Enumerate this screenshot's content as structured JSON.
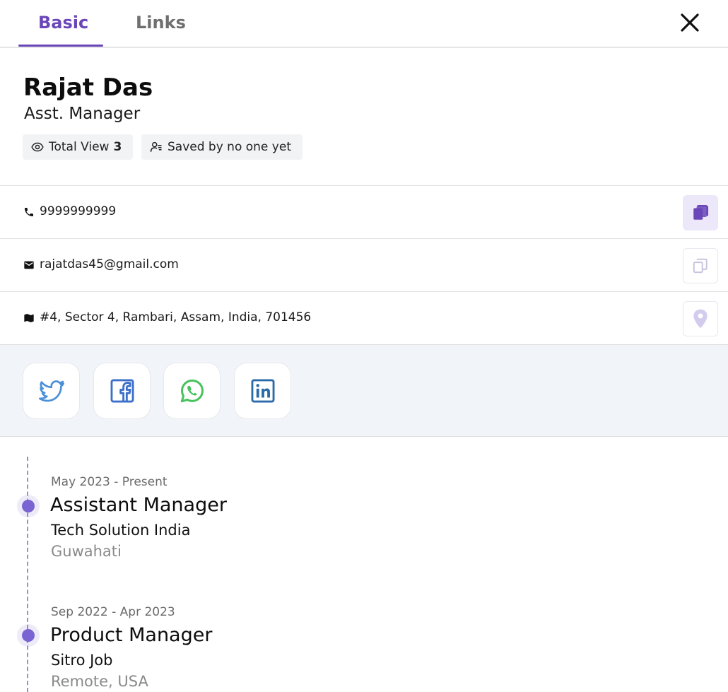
{
  "tabs": [
    {
      "label": "Basic",
      "active": true
    },
    {
      "label": "Links",
      "active": false
    }
  ],
  "accent_color": "#6a46b8",
  "profile": {
    "name": "Rajat Das",
    "role": "Asst. Manager",
    "views_label": "Total View",
    "views_count": "3",
    "saved_label": "Saved by no one yet"
  },
  "contacts": {
    "phone": "9999999999",
    "email": "rajatdas45@gmail.com",
    "address": "#4, Sector 4, Rambari, Assam, India, 701456"
  },
  "social": [
    {
      "name": "twitter",
      "color": "#4a90d9"
    },
    {
      "name": "facebook",
      "color": "#3b6fc9"
    },
    {
      "name": "whatsapp",
      "color": "#48c25d"
    },
    {
      "name": "linkedin",
      "color": "#2a6aa8"
    }
  ],
  "experience": [
    {
      "date": "May 2023 - Present",
      "title": "Assistant Manager",
      "company": "Tech Solution India",
      "location": "Guwahati"
    },
    {
      "date": "Sep 2022 - Apr 2023",
      "title": "Product Manager",
      "company": "Sitro Job",
      "location": "Remote, USA"
    }
  ]
}
